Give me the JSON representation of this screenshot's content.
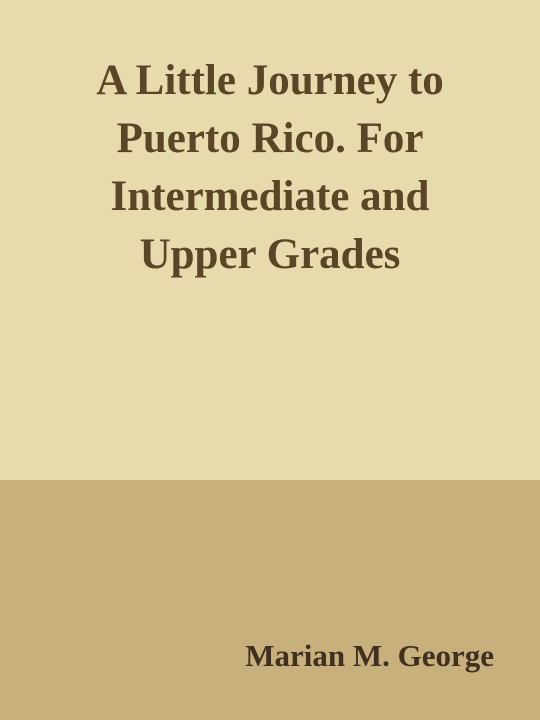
{
  "cover": {
    "title_lines": [
      "A Little Journey to",
      "Puerto Rico. For",
      "Intermediate and",
      "Upper Grades"
    ],
    "author": "Marian M. George"
  },
  "colors": {
    "top_background": "#e7daac",
    "bottom_background": "#c8b07c",
    "title_text": "#5a4527",
    "author_text": "#3f3020"
  }
}
